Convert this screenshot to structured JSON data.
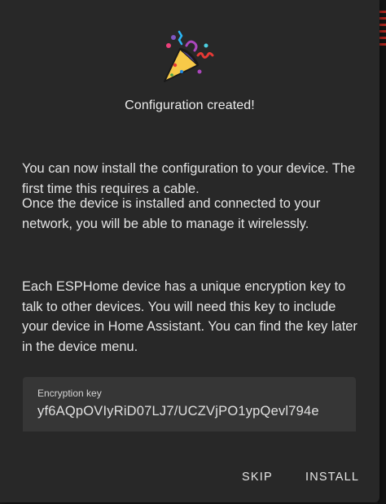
{
  "dialog": {
    "icon": "party-popper-icon",
    "title": "Configuration created!",
    "paragraphs": [
      "You can now install the configuration to your device. The first time this requires a cable.",
      "Once the device is installed and connected to your network, you will be able to manage it wirelessly.",
      "Each ESPHome device has a unique encryption key to talk to other devices. You will need this key to include your device in Home Assistant. You can find the key later in the device menu."
    ],
    "encryption_key": {
      "label": "Encryption key",
      "value": "yf6AQpOVIyRiD07LJ7/UCZVjPO1ypQevl794e"
    },
    "actions": {
      "skip": "SKIP",
      "install": "INSTALL"
    }
  },
  "colors": {
    "dialog_background": "#282828",
    "field_background": "#363636",
    "text": "#e4e4e4",
    "popper_cone": "#f7c948"
  }
}
